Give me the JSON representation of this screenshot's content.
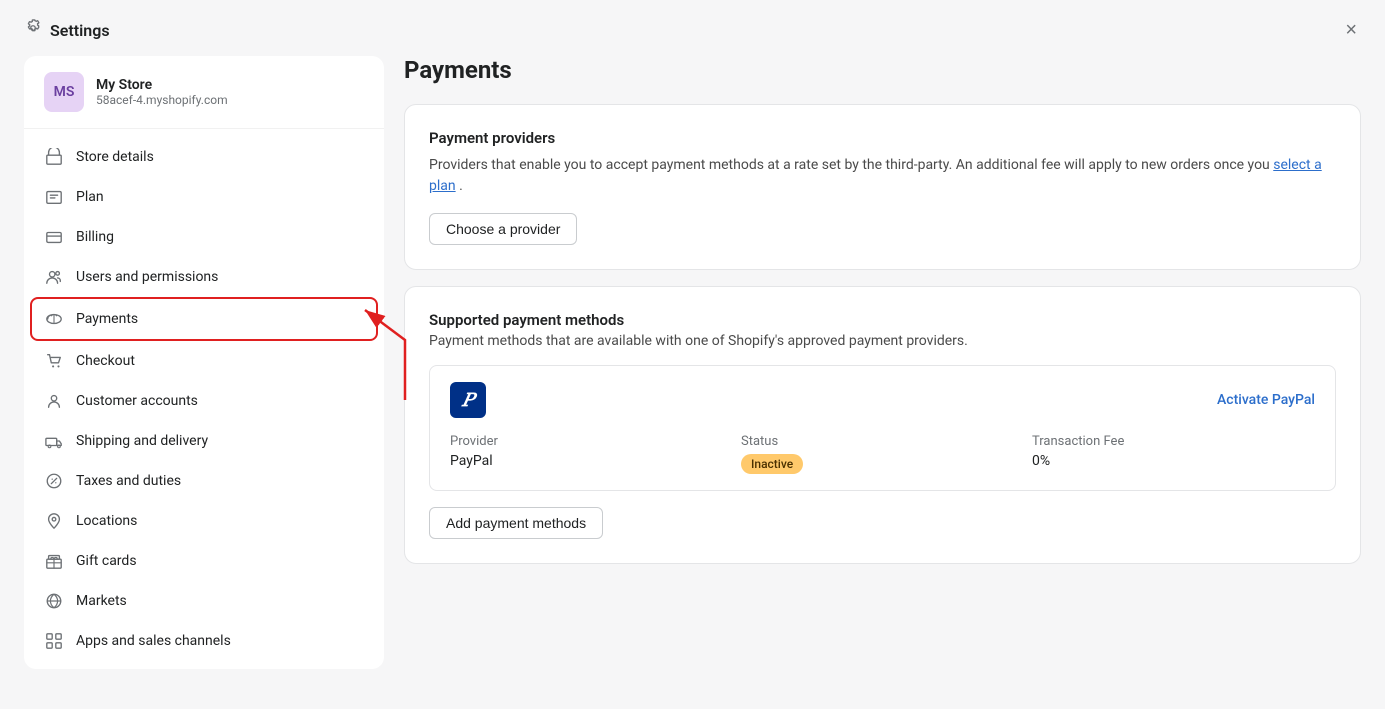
{
  "titleBar": {
    "title": "Settings",
    "closeLabel": "×"
  },
  "sidebar": {
    "store": {
      "initials": "MS",
      "name": "My Store",
      "url": "58acef-4.myshopify.com"
    },
    "navItems": [
      {
        "id": "store-details",
        "label": "Store details",
        "icon": "store"
      },
      {
        "id": "plan",
        "label": "Plan",
        "icon": "plan"
      },
      {
        "id": "billing",
        "label": "Billing",
        "icon": "billing"
      },
      {
        "id": "users-permissions",
        "label": "Users and permissions",
        "icon": "users"
      },
      {
        "id": "payments",
        "label": "Payments",
        "icon": "payments",
        "active": true
      },
      {
        "id": "checkout",
        "label": "Checkout",
        "icon": "checkout"
      },
      {
        "id": "customer-accounts",
        "label": "Customer accounts",
        "icon": "customer"
      },
      {
        "id": "shipping-delivery",
        "label": "Shipping and delivery",
        "icon": "shipping"
      },
      {
        "id": "taxes-duties",
        "label": "Taxes and duties",
        "icon": "taxes"
      },
      {
        "id": "locations",
        "label": "Locations",
        "icon": "locations"
      },
      {
        "id": "gift-cards",
        "label": "Gift cards",
        "icon": "gift"
      },
      {
        "id": "markets",
        "label": "Markets",
        "icon": "markets"
      },
      {
        "id": "apps-sales-channels",
        "label": "Apps and sales channels",
        "icon": "apps"
      }
    ]
  },
  "main": {
    "pageTitle": "Payments",
    "paymentProviders": {
      "cardTitle": "Payment providers",
      "cardDesc": "Providers that enable you to accept payment methods at a rate set by the third-party. An additional fee will apply to new orders once you",
      "cardDescLink": "select a plan",
      "cardDescEnd": ".",
      "chooseProviderBtn": "Choose a provider"
    },
    "supportedMethods": {
      "cardTitle": "Supported payment methods",
      "cardDesc": "Payment methods that are available with one of Shopify's approved payment providers.",
      "paypal": {
        "logoText": "P",
        "activateLink": "Activate PayPal",
        "providerLabel": "Provider",
        "providerValue": "PayPal",
        "statusLabel": "Status",
        "statusValue": "Inactive",
        "feeLabel": "Transaction Fee",
        "feeValue": "0%"
      },
      "addMethodBtn": "Add payment methods"
    }
  }
}
